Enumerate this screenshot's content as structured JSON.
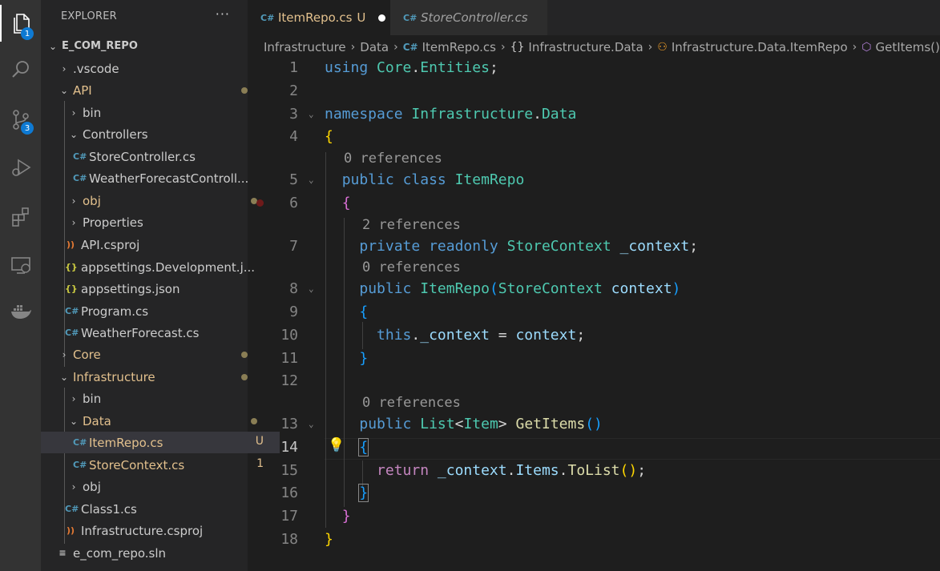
{
  "activity_bar": {
    "explorer_badge": "1",
    "scm_badge": "3",
    "icons": [
      "files-icon",
      "search-icon",
      "source-control-icon",
      "run-debug-icon",
      "extensions-icon",
      "remote-explorer-icon",
      "docker-icon"
    ]
  },
  "sidebar": {
    "title": "EXPLORER",
    "more": "···",
    "root": "E_COM_REPO",
    "items": [
      {
        "label": ".vscode"
      },
      {
        "label": "API"
      },
      {
        "label": "bin"
      },
      {
        "label": "Controllers"
      },
      {
        "label": "StoreController.cs"
      },
      {
        "label": "WeatherForecastControll..."
      },
      {
        "label": "obj"
      },
      {
        "label": "Properties"
      },
      {
        "label": "API.csproj"
      },
      {
        "label": "appsettings.Development.j..."
      },
      {
        "label": "appsettings.json"
      },
      {
        "label": "Program.cs"
      },
      {
        "label": "WeatherForecast.cs"
      },
      {
        "label": "Core"
      },
      {
        "label": "Infrastructure"
      },
      {
        "label": "bin"
      },
      {
        "label": "Data"
      },
      {
        "label": "ItemRepo.cs",
        "decoration": "U"
      },
      {
        "label": "StoreContext.cs",
        "decoration": "1"
      },
      {
        "label": "obj"
      },
      {
        "label": "Class1.cs"
      },
      {
        "label": "Infrastructure.csproj"
      },
      {
        "label": "e_com_repo.sln"
      }
    ]
  },
  "tabs": [
    {
      "label": "ItemRepo.cs",
      "status": "U"
    },
    {
      "label": "StoreController.cs"
    }
  ],
  "breadcrumb": [
    "Infrastructure",
    "Data",
    "ItemRepo.cs",
    "Infrastructure.Data",
    "Infrastructure.Data.ItemRepo",
    "GetItems()"
  ],
  "editor": {
    "line_numbers": [
      "1",
      "2",
      "3",
      "4",
      "5",
      "6",
      "7",
      "8",
      "9",
      "10",
      "11",
      "12",
      "13",
      "14",
      "15",
      "16",
      "17",
      "18"
    ],
    "codelens": {
      "class_refs": "0 references",
      "field_refs": "2 references",
      "ctor_refs": "0 references",
      "method_refs": "0 references"
    },
    "lines": {
      "l1": [
        "using",
        "Core",
        ".",
        "Entities",
        ";"
      ],
      "l3": [
        "namespace",
        "Infrastructure",
        ".",
        "Data"
      ],
      "l4": [
        "{"
      ],
      "l5": [
        "public",
        "class",
        "ItemRepo"
      ],
      "l6": [
        "{"
      ],
      "l7": [
        "private",
        "readonly",
        "StoreContext",
        "_context",
        ";"
      ],
      "l8": [
        "public",
        "ItemRepo",
        "(",
        "StoreContext",
        "context",
        ")"
      ],
      "l9": [
        "{"
      ],
      "l10": [
        "this",
        ".",
        "_context",
        " = ",
        "context",
        ";"
      ],
      "l11": [
        "}"
      ],
      "l13": [
        "public",
        "List",
        "<",
        "Item",
        ">",
        "GetItems",
        "(",
        ")"
      ],
      "l14": [
        "{"
      ],
      "l15": [
        "return",
        "_context",
        ".",
        "Items",
        ".",
        "ToList",
        "(",
        ")",
        ";"
      ],
      "l16": [
        "}"
      ],
      "l17": [
        "}"
      ],
      "l18": [
        "}"
      ]
    }
  }
}
